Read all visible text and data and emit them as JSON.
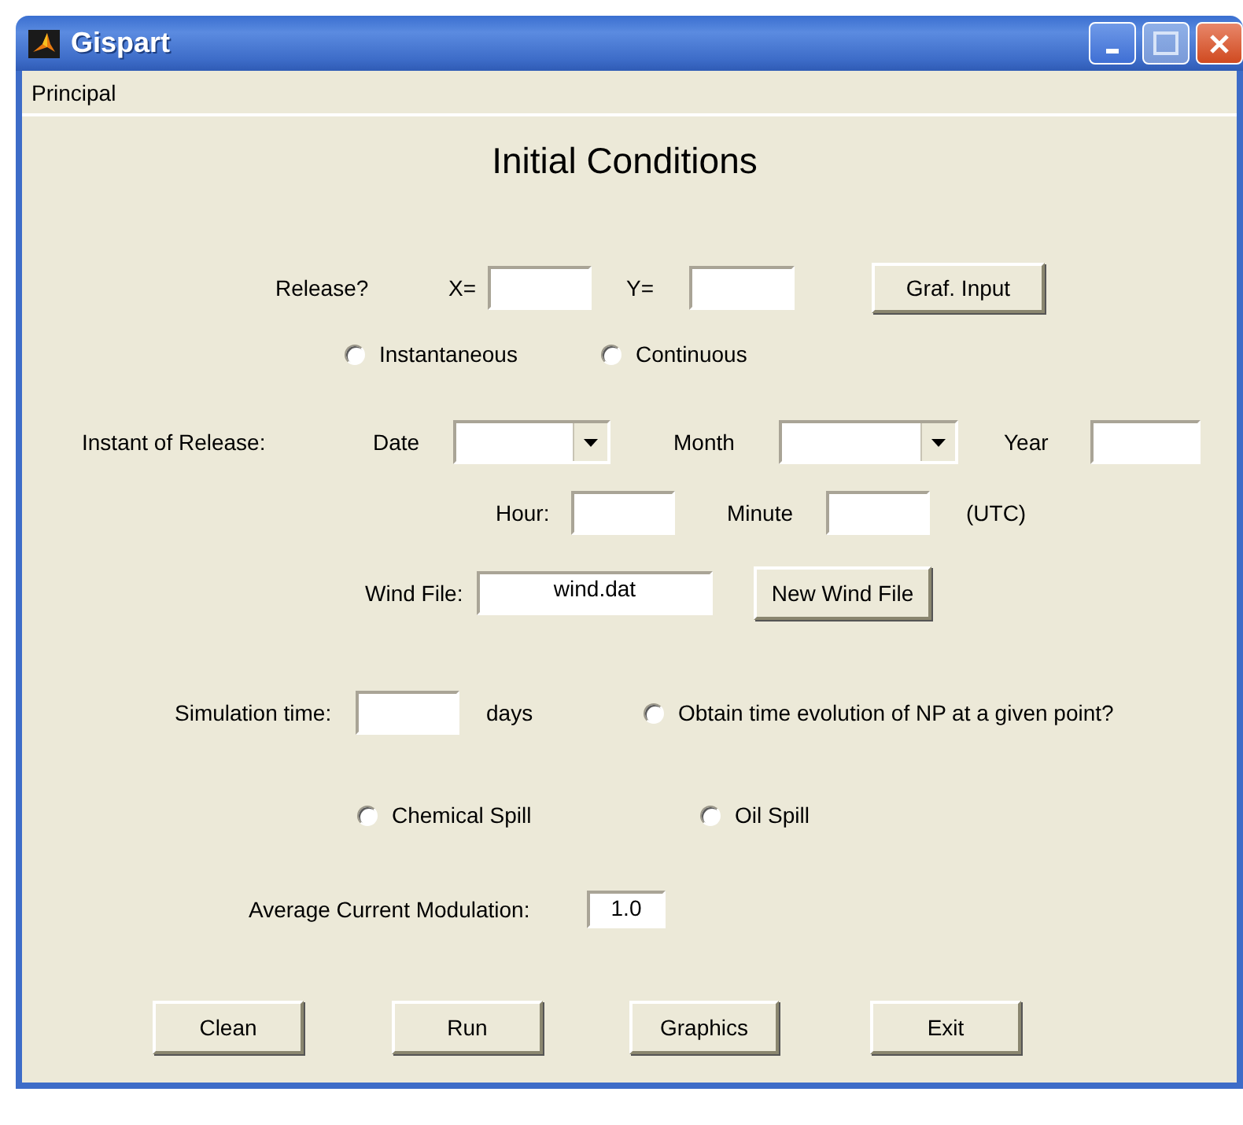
{
  "window": {
    "title": "Gispart"
  },
  "menu": [
    {
      "label": "Principal"
    }
  ],
  "heading": "Initial Conditions",
  "rows": [
    {
      "items": [
        {
          "kind": "label",
          "text": "Release?"
        },
        {
          "kind": "label",
          "text": "X="
        },
        {
          "kind": "input"
        },
        {
          "kind": "label",
          "text": "Y="
        },
        {
          "kind": "input"
        },
        {
          "kind": "button",
          "label": "Graf. Input"
        }
      ]
    },
    {
      "items": [
        {
          "kind": "radio",
          "label": "Instantaneous",
          "selected": false
        },
        {
          "kind": "radio",
          "label": "Continuous",
          "selected": false
        }
      ]
    },
    {
      "items": [
        {
          "kind": "label",
          "text": "Instant of Release:"
        },
        {
          "kind": "label",
          "text": "Date"
        },
        {
          "kind": "dropdown"
        },
        {
          "kind": "label",
          "text": "Month"
        },
        {
          "kind": "dropdown"
        },
        {
          "kind": "label",
          "text": "Year"
        },
        {
          "kind": "input"
        }
      ]
    },
    {
      "items": [
        {
          "kind": "label",
          "text": "Hour:"
        },
        {
          "kind": "input"
        },
        {
          "kind": "label",
          "text": "Minute"
        },
        {
          "kind": "input"
        },
        {
          "kind": "label",
          "text": "(UTC)"
        }
      ]
    },
    {
      "items": [
        {
          "kind": "label",
          "text": "Wind File:"
        },
        {
          "kind": "input",
          "value": "wind.dat"
        },
        {
          "kind": "button",
          "label": "New Wind File"
        }
      ]
    },
    {
      "items": [
        {
          "kind": "label",
          "text": "Simulation time:"
        },
        {
          "kind": "input"
        },
        {
          "kind": "label",
          "text": "days"
        },
        {
          "kind": "radio",
          "label": "Obtain time evolution of NP at a given point?",
          "selected": false
        }
      ]
    },
    {
      "items": [
        {
          "kind": "radio",
          "label": "Chemical Spill",
          "selected": false
        },
        {
          "kind": "radio",
          "label": "Oil Spill",
          "selected": false
        }
      ]
    },
    {
      "items": [
        {
          "kind": "label",
          "text": "Average Current Modulation:"
        },
        {
          "kind": "input",
          "value": "1.0"
        }
      ]
    },
    {
      "items": [
        {
          "kind": "button",
          "label": "Clean"
        },
        {
          "kind": "button",
          "label": "Run"
        },
        {
          "kind": "button",
          "label": "Graphics"
        },
        {
          "kind": "button",
          "label": "Exit"
        }
      ]
    }
  ]
}
